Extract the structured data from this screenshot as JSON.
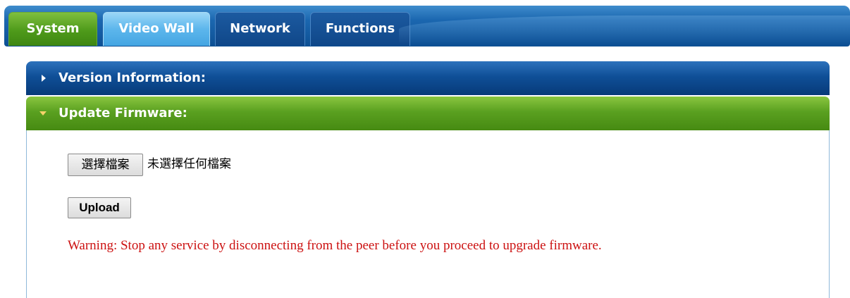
{
  "tabs": [
    {
      "label": "System",
      "state": "active"
    },
    {
      "label": "Video Wall",
      "state": "hover"
    },
    {
      "label": "Network",
      "state": "inactive"
    },
    {
      "label": "Functions",
      "state": "inactive"
    }
  ],
  "sections": {
    "version": {
      "title": "Version Information:",
      "expanded": false,
      "icon": "caret-right-icon"
    },
    "firmware": {
      "title": "Update Firmware:",
      "expanded": true,
      "icon": "caret-down-icon"
    }
  },
  "firmware": {
    "choose_file_label": "選擇檔案",
    "no_file_text": "未選擇任何檔案",
    "upload_label": "Upload",
    "warning": "Warning: Stop any service by disconnecting from the peer before you proceed to upgrade firmware."
  },
  "colors": {
    "tab_bar": "#1b67b0",
    "active_tab": "#4e9a1a",
    "hover_tab": "#5cb6ec",
    "version_header": "#0f4f97",
    "firmware_header": "#5aa020",
    "warning_text": "#cc1111"
  }
}
